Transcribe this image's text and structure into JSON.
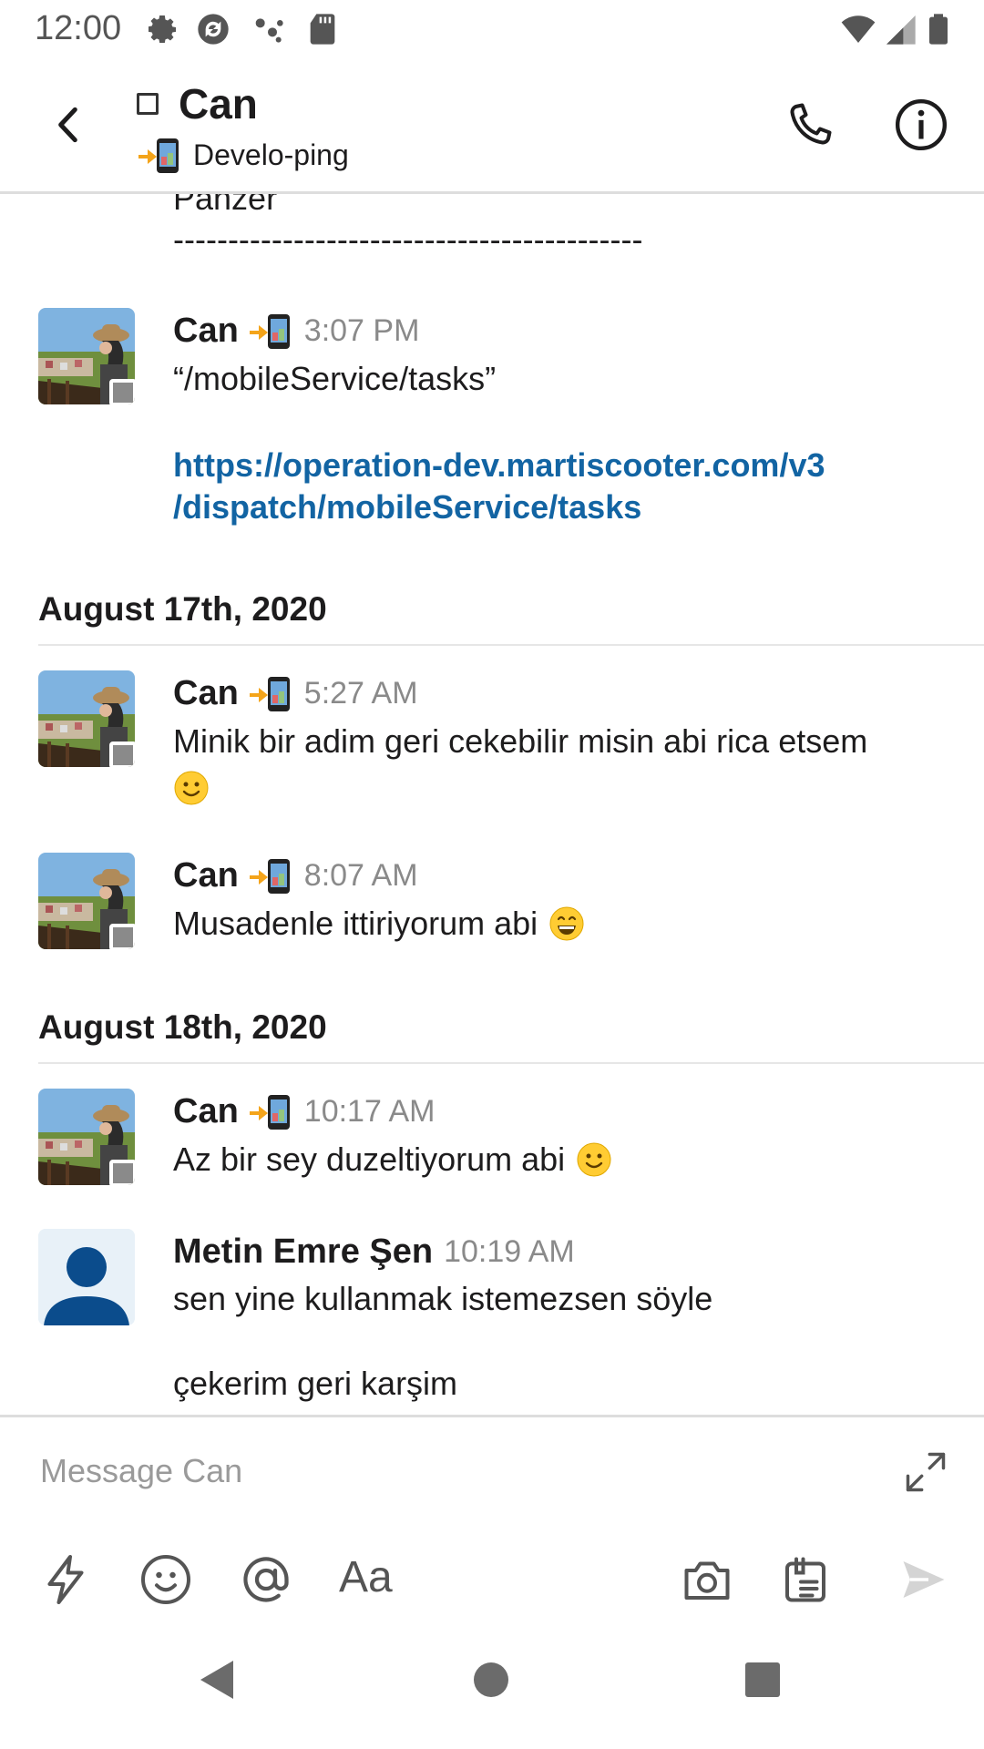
{
  "status_bar": {
    "time": "12:00",
    "icons": [
      "settings-icon",
      "sync-icon",
      "assistant-icon",
      "sd-card-icon",
      "wifi-icon",
      "signal-icon",
      "battery-icon"
    ]
  },
  "header": {
    "title": "Can",
    "subtitle": "Develo-ping",
    "icons": [
      "back-arrow-icon",
      "phone-icon",
      "info-icon"
    ]
  },
  "messages": {
    "partial_top": {
      "line1": "Panzer",
      "line2": "-------------------------------------------"
    },
    "msg1": {
      "sender": "Can",
      "time": "3:07 PM",
      "text": "“/mobileService/tasks”",
      "link_line1": "https://operation-dev.martiscooter.com/v3",
      "link_line2": "/dispatch/mobileService/tasks"
    },
    "date1": "August 17th, 2020",
    "msg2": {
      "sender": "Can",
      "time": "5:27 AM",
      "text": "Minik bir adim geri cekebilir misin abi rica etsem",
      "emoji": "slightly-smiling-face"
    },
    "msg3": {
      "sender": "Can",
      "time": "8:07 AM",
      "text": "Musadenle ittiriyorum abi",
      "emoji": "grinning-face"
    },
    "date2": "August 18th, 2020",
    "msg4": {
      "sender": "Can",
      "time": "10:17 AM",
      "text": "Az bir sey duzeltiyorum abi",
      "emoji": "slightly-smiling-face"
    },
    "msg5": {
      "sender": "Metin Emre Şen",
      "time": "10:19 AM",
      "line1": "sen yine kullanmak istemezsen söyle",
      "line2": "çekerim geri karşim"
    }
  },
  "composer": {
    "placeholder": "Message Can",
    "aa_label": "Aa",
    "icons": [
      "lightning-icon",
      "emoji-icon",
      "mention-icon",
      "camera-icon",
      "clipboard-icon",
      "send-icon",
      "expand-icon"
    ]
  },
  "colors": {
    "link": "#1264a3",
    "timestamp": "#8a8a8a",
    "divider": "#e6e6e6",
    "avatar_default_bg": "#e8f1f8",
    "avatar_default_fg": "#0b4c8c"
  }
}
